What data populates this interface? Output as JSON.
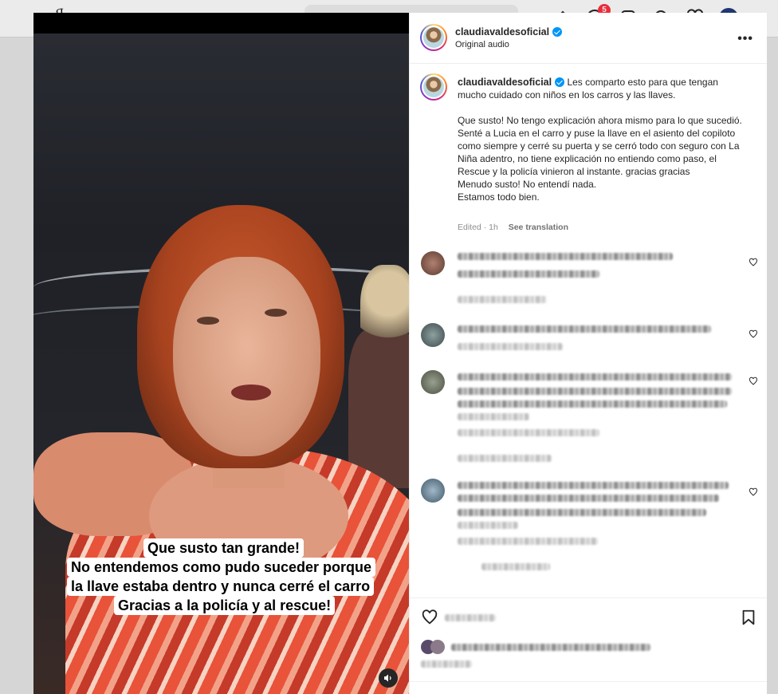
{
  "background": {
    "notification_count": "5"
  },
  "media": {
    "caption_lines": [
      "Que susto tan grande!",
      "No entendemos como pudo suceder porque",
      "la llave estaba dentro y nunca cerré el carro",
      "Gracias a la policía y al rescue!"
    ],
    "mute_icon": "speaker-mute-icon"
  },
  "header": {
    "username": "claudiavaldesoficial",
    "subtitle": "Original audio",
    "more_icon": "more-horizontal-icon"
  },
  "post_caption": {
    "username": "claudiavaldesoficial",
    "intro": "Les comparto esto para que tengan mucho cuidado con niños en los carros y las llaves.",
    "body": "Que susto! No tengo explicación ahora mismo para lo que sucedió. Senté a Lucia en el carro y puse la llave en el asiento del copiloto como siempre y cerré su puerta y se cerró todo con seguro con La Niña adentro, no tiene explicación no entiendo como paso, el Rescue y la policía vinieron al instante. gracias gracias\nMenudo susto! No entendí nada.\nEstamos todo bien.",
    "edited": "Edited · 1h",
    "see_translation": "See translation"
  },
  "comments_note": "Comment authors, texts and timestamps are pixelated/unreadable in the screenshot.",
  "actions": {
    "save_icon": "bookmark-icon"
  },
  "colors": {
    "accent": "#0095f6",
    "text": "#262626",
    "muted": "#8e8e8e",
    "badge": "#ff3040"
  }
}
